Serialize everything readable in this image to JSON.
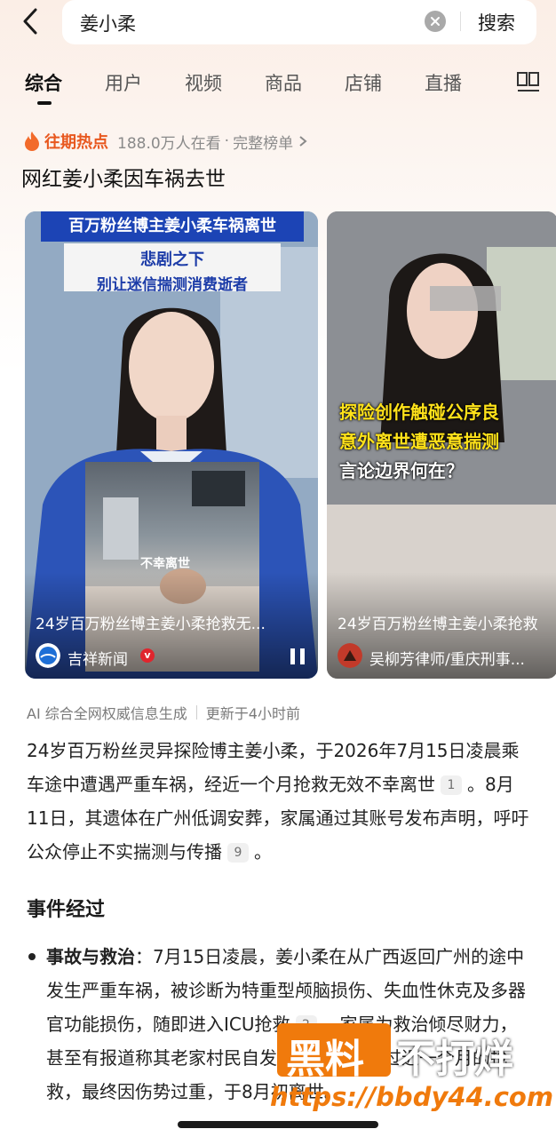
{
  "search": {
    "query": "姜小柔",
    "button_label": "搜索"
  },
  "tabs": [
    {
      "label": "综合",
      "active": true
    },
    {
      "label": "用户"
    },
    {
      "label": "视频"
    },
    {
      "label": "商品"
    },
    {
      "label": "店铺"
    },
    {
      "label": "直播"
    }
  ],
  "hot": {
    "label": "往期热点",
    "viewers": "188.0万人在看",
    "separator": "·",
    "link": "完整榜单",
    "title": "网红姜小柔因车祸去世"
  },
  "cards": [
    {
      "banner_top": "百万粉丝博主姜小柔车祸离世",
      "banner_line1": "悲剧之下",
      "banner_line2": "别让迷信揣测消费逝者",
      "inset_text": "不幸离世",
      "caption": "24岁百万粉丝博主姜小柔抢救无...",
      "source": "吉祥新闻"
    },
    {
      "overlay_line1": "探险创作触碰公序良",
      "overlay_line2": "意外离世遭恶意揣测",
      "overlay_line3": "言论边界何在？",
      "caption": "24岁百万粉丝博主姜小柔抢救",
      "source": "吴柳芳律师/重庆刑事..."
    }
  ],
  "ai": {
    "source_note": "AI 综合全网权威信息生成",
    "updated": "更新于4小时前"
  },
  "summary": {
    "text1": "24岁百万粉丝灵异探险博主姜小柔，于2026年7月15日凌晨乘车途中遭遇严重车祸，经近一个月抢救无效不幸离世",
    "cite1": "1",
    "text2": "。8月11日，其遗体在广州低调安葬，家属通过其账号发布声明，呼吁公众停止不实揣测与传播",
    "cite2": "9",
    "text3": "。"
  },
  "section": {
    "title": "事件经过",
    "bullet_label": "事故与救治",
    "bullet_text1": "：7月15日凌晨，姜小柔在从广西返回广州的途中发生严重车祸，被诊断为特重型颅脑损伤、失血性休克及多器官功能损伤，随即进入ICU抢救",
    "cite": "2",
    "bullet_text2": "。家属为救治倾尽财力，甚至有报道称其老家村民自发捐款帮扶。经过近一个月的抢救，最终因伤势过重，于8月初离世。"
  },
  "watermark": {
    "brand1": "黑料",
    "brand2": "不打烊",
    "url": "https://bbdy44.com"
  },
  "colors": {
    "accent": "#e8581f",
    "watermark": "#f07a0c",
    "banner_blue": "#1c44b5"
  }
}
